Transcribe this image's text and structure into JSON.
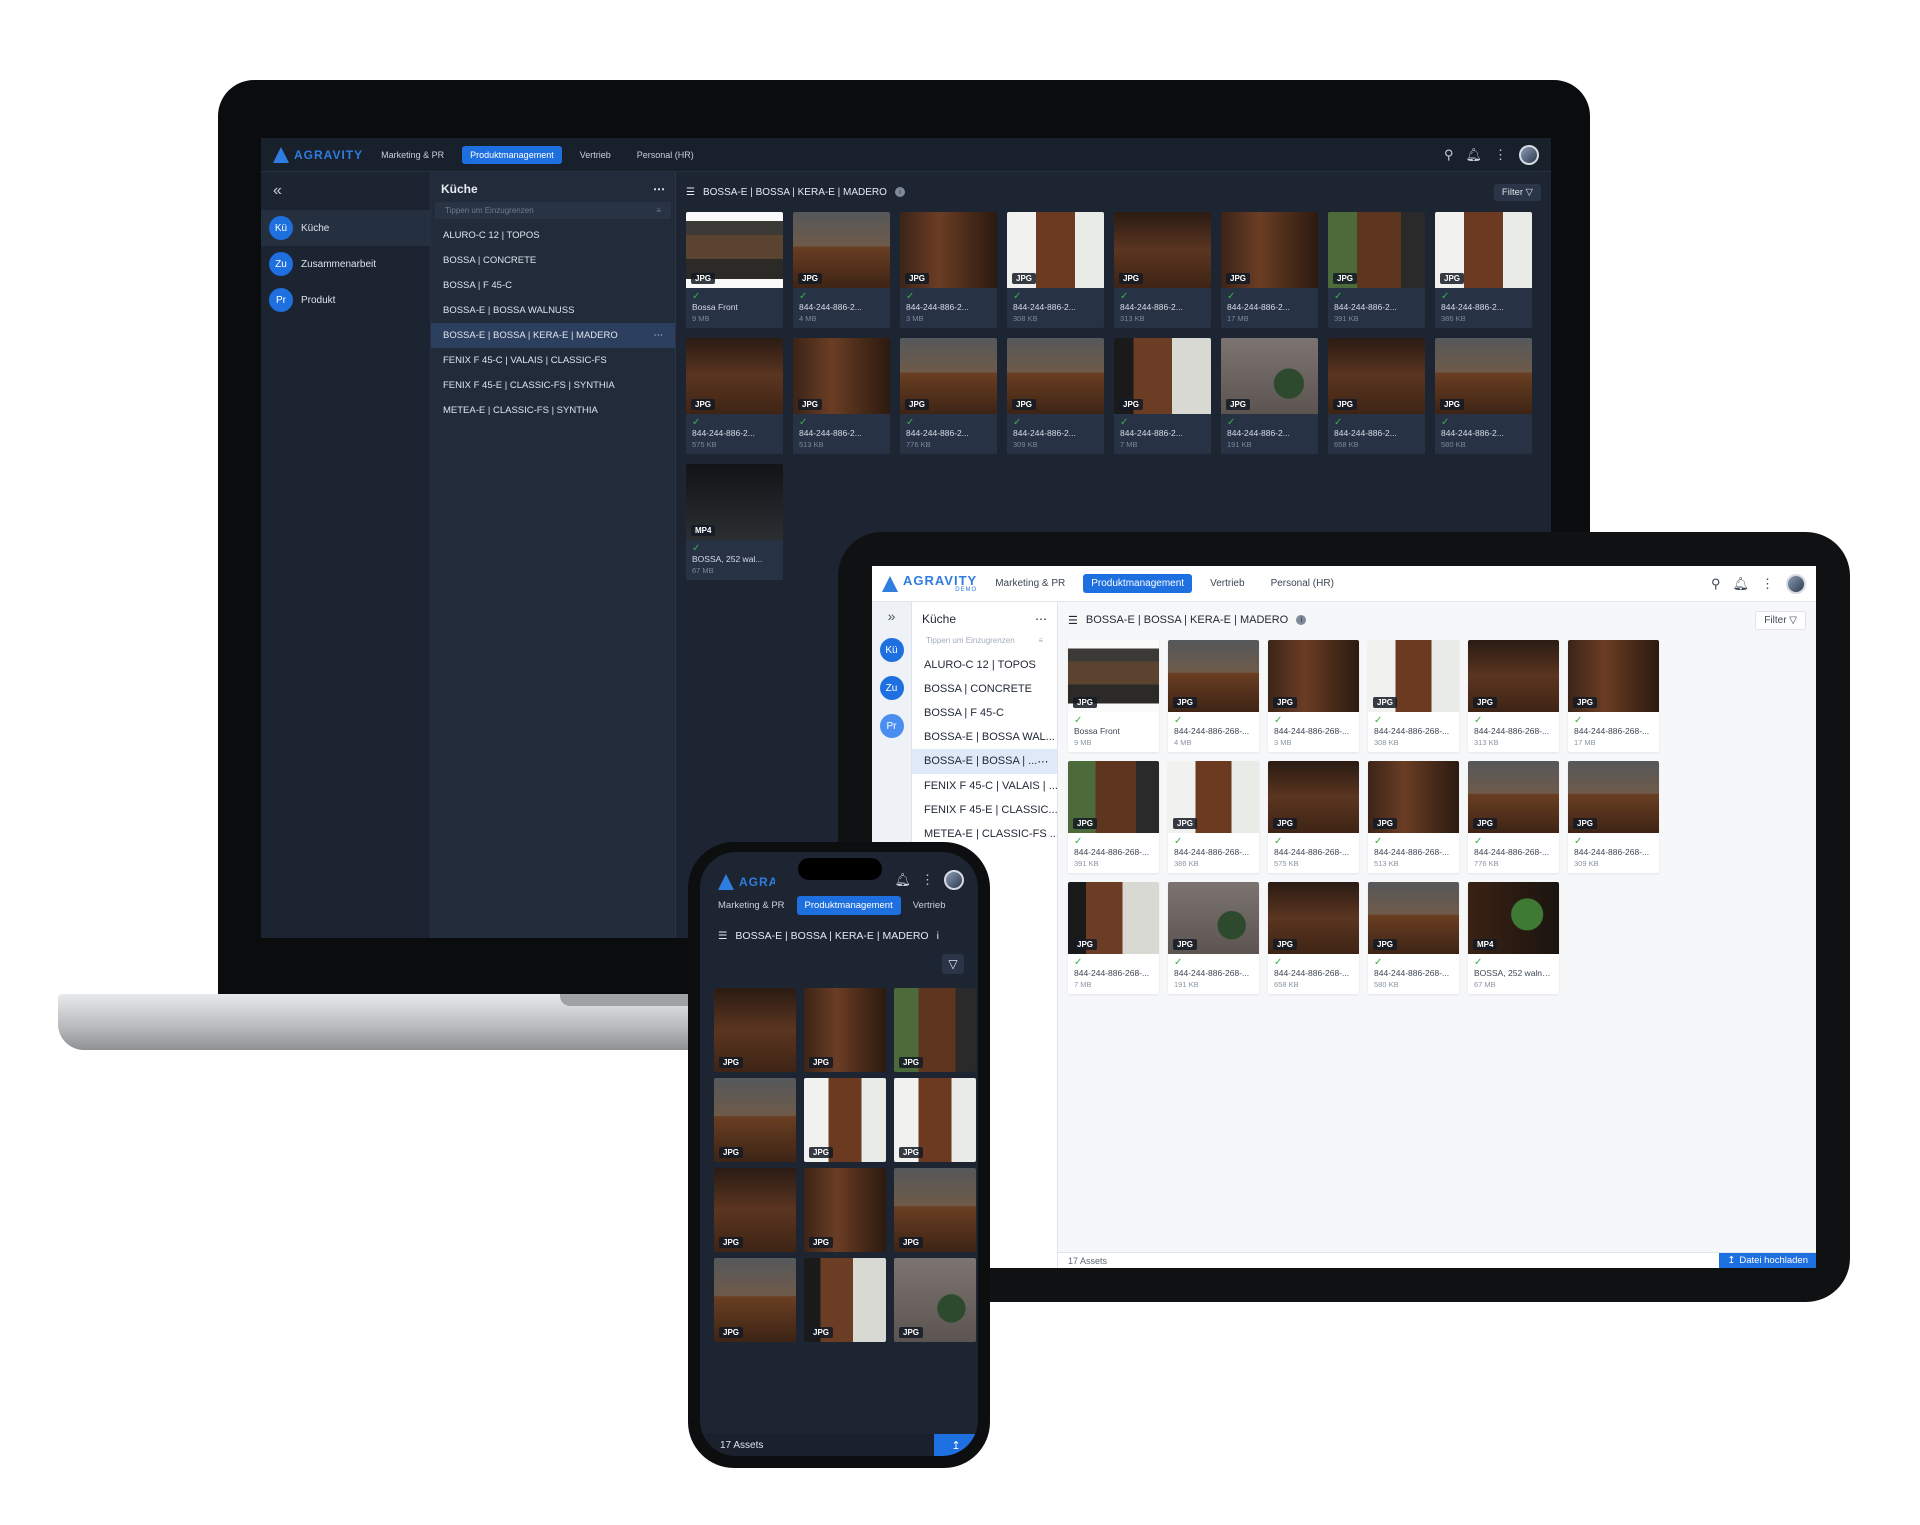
{
  "app": {
    "logo_text": "AGRAVITY",
    "logo_sub": "DEMO",
    "tabs": [
      {
        "label": "Marketing & PR"
      },
      {
        "label": "Produktmanagement"
      },
      {
        "label": "Vertrieb"
      },
      {
        "label": "Personal (HR)"
      }
    ],
    "active_tab_index": 1,
    "accent_color": "#1e6fe0",
    "success_color": "#35b24a"
  },
  "sidebar": {
    "items": [
      {
        "initials": "Kü",
        "label": "Küche"
      },
      {
        "initials": "Zu",
        "label": "Zusammenarbeit"
      },
      {
        "initials": "Pr",
        "label": "Produkt"
      }
    ]
  },
  "collection_list": {
    "title": "Küche",
    "search_placeholder": "Tippen um Einzugrenzen",
    "items": [
      {
        "label": "ALURO-C 12 | TOPOS"
      },
      {
        "label": "BOSSA | CONCRETE"
      },
      {
        "label": "BOSSA | F 45-C"
      },
      {
        "label": "BOSSA-E | BOSSA WALNUSS"
      },
      {
        "label": "BOSSA-E | BOSSA | KERA-E | MADERO"
      },
      {
        "label": "FENIX F 45-C | VALAIS | CLASSIC-FS"
      },
      {
        "label": "FENIX F 45-E | CLASSIC-FS | SYNTHIA"
      },
      {
        "label": "METEA-E | CLASSIC-FS | SYNTHIA"
      }
    ],
    "tablet_items": [
      {
        "label": "ALURO-C 12 | TOPOS"
      },
      {
        "label": "BOSSA | CONCRETE"
      },
      {
        "label": "BOSSA | F 45-C"
      },
      {
        "label": "BOSSA-E | BOSSA WAL..."
      },
      {
        "label": "BOSSA-E | BOSSA | ..."
      },
      {
        "label": "FENIX F 45-C | VALAIS | ..."
      },
      {
        "label": "FENIX F 45-E | CLASSIC..."
      },
      {
        "label": "METEA-E | CLASSIC-FS ..."
      }
    ],
    "active_index": 4
  },
  "main": {
    "breadcrumb": "BOSSA-E | BOSSA | KERA-E | MADERO",
    "filter_label": "Filter",
    "asset_count": "17 Assets",
    "upload_label": "Datei hochladen"
  },
  "laptop_assets": [
    {
      "type": "JPG",
      "name": "Bossa Front",
      "size": "9 MB",
      "tex": "t-front"
    },
    {
      "type": "JPG",
      "name": "844-244-886-2...",
      "size": "4 MB",
      "tex": "t-room"
    },
    {
      "type": "JPG",
      "name": "844-244-886-2...",
      "size": "3 MB",
      "tex": "t-wood"
    },
    {
      "type": "JPG",
      "name": "844-244-886-2...",
      "size": "308 KB",
      "tex": "t-light"
    },
    {
      "type": "JPG",
      "name": "844-244-886-2...",
      "size": "313 KB",
      "tex": "t-wood2"
    },
    {
      "type": "JPG",
      "name": "844-244-886-2...",
      "size": "17 MB",
      "tex": "t-wood"
    },
    {
      "type": "JPG",
      "name": "844-244-886-2...",
      "size": "391 KB",
      "tex": "t-green"
    },
    {
      "type": "JPG",
      "name": "844-244-886-2...",
      "size": "386 KB",
      "tex": "t-light"
    },
    {
      "type": "JPG",
      "name": "844-244-886-2...",
      "size": "575 KB",
      "tex": "t-wood2"
    },
    {
      "type": "JPG",
      "name": "844-244-886-2...",
      "size": "513 KB",
      "tex": "t-wood"
    },
    {
      "type": "JPG",
      "name": "844-244-886-2...",
      "size": "776 KB",
      "tex": "t-room"
    },
    {
      "type": "JPG",
      "name": "844-244-886-2...",
      "size": "309 KB",
      "tex": "t-room"
    },
    {
      "type": "JPG",
      "name": "844-244-886-2...",
      "size": "7 MB",
      "tex": "t-shelf"
    },
    {
      "type": "JPG",
      "name": "844-244-886-2...",
      "size": "191 KB",
      "tex": "t-grey"
    },
    {
      "type": "JPG",
      "name": "844-244-886-2...",
      "size": "658 KB",
      "tex": "t-wood2"
    },
    {
      "type": "JPG",
      "name": "844-244-886-2...",
      "size": "580 KB",
      "tex": "t-room"
    },
    {
      "type": "MP4",
      "name": "BOSSA, 252 wal...",
      "size": "67 MB",
      "tex": "t-dark"
    }
  ],
  "tablet_assets": [
    {
      "type": "JPG",
      "name": "Bossa Front",
      "size": "9 MB",
      "tex": "t-front"
    },
    {
      "type": "JPG",
      "name": "844-244-886-268-...",
      "size": "4 MB",
      "tex": "t-room"
    },
    {
      "type": "JPG",
      "name": "844-244-886-268-...",
      "size": "3 MB",
      "tex": "t-wood"
    },
    {
      "type": "JPG",
      "name": "844-244-886-268-...",
      "size": "308 KB",
      "tex": "t-light"
    },
    {
      "type": "JPG",
      "name": "844-244-886-268-...",
      "size": "313 KB",
      "tex": "t-wood2"
    },
    {
      "type": "JPG",
      "name": "844-244-886-268-...",
      "size": "17 MB",
      "tex": "t-wood"
    },
    {
      "type": "JPG",
      "name": "844-244-886-268-...",
      "size": "391 KB",
      "tex": "t-green"
    },
    {
      "type": "JPG",
      "name": "844-244-886-268-...",
      "size": "386 KB",
      "tex": "t-light"
    },
    {
      "type": "JPG",
      "name": "844-244-886-268-...",
      "size": "575 KB",
      "tex": "t-wood2"
    },
    {
      "type": "JPG",
      "name": "844-244-886-268-...",
      "size": "513 KB",
      "tex": "t-wood"
    },
    {
      "type": "JPG",
      "name": "844-244-886-268-...",
      "size": "776 KB",
      "tex": "t-room"
    },
    {
      "type": "JPG",
      "name": "844-244-886-268-...",
      "size": "309 KB",
      "tex": "t-room"
    },
    {
      "type": "JPG",
      "name": "844-244-886-268-...",
      "size": "7 MB",
      "tex": "t-shelf"
    },
    {
      "type": "JPG",
      "name": "844-244-886-268-...",
      "size": "191 KB",
      "tex": "t-grey"
    },
    {
      "type": "JPG",
      "name": "844-244-886-268-...",
      "size": "658 KB",
      "tex": "t-wood2"
    },
    {
      "type": "JPG",
      "name": "844-244-886-268-...",
      "size": "580 KB",
      "tex": "t-room"
    },
    {
      "type": "MP4",
      "name": "BOSSA, 252 walnut...",
      "size": "67 MB",
      "tex": "t-plant"
    }
  ],
  "phone_assets": [
    {
      "type": "JPG",
      "tex": "t-wood2"
    },
    {
      "type": "JPG",
      "tex": "t-wood"
    },
    {
      "type": "JPG",
      "tex": "t-green"
    },
    {
      "type": "JPG",
      "tex": "t-room"
    },
    {
      "type": "JPG",
      "tex": "t-light"
    },
    {
      "type": "JPG",
      "tex": "t-light"
    },
    {
      "type": "JPG",
      "tex": "t-wood2"
    },
    {
      "type": "JPG",
      "tex": "t-wood"
    },
    {
      "type": "JPG",
      "tex": "t-room"
    },
    {
      "type": "JPG",
      "tex": "t-room"
    },
    {
      "type": "JPG",
      "tex": "t-shelf"
    },
    {
      "type": "JPG",
      "tex": "t-grey"
    }
  ],
  "icons": {
    "search": "search-icon",
    "bell": "bell-icon",
    "more": "more-vertical-icon",
    "filter": "filter-icon",
    "menu": "menu-icon",
    "info": "info-icon",
    "collapse": "collapse-icon",
    "upload": "upload-icon"
  }
}
